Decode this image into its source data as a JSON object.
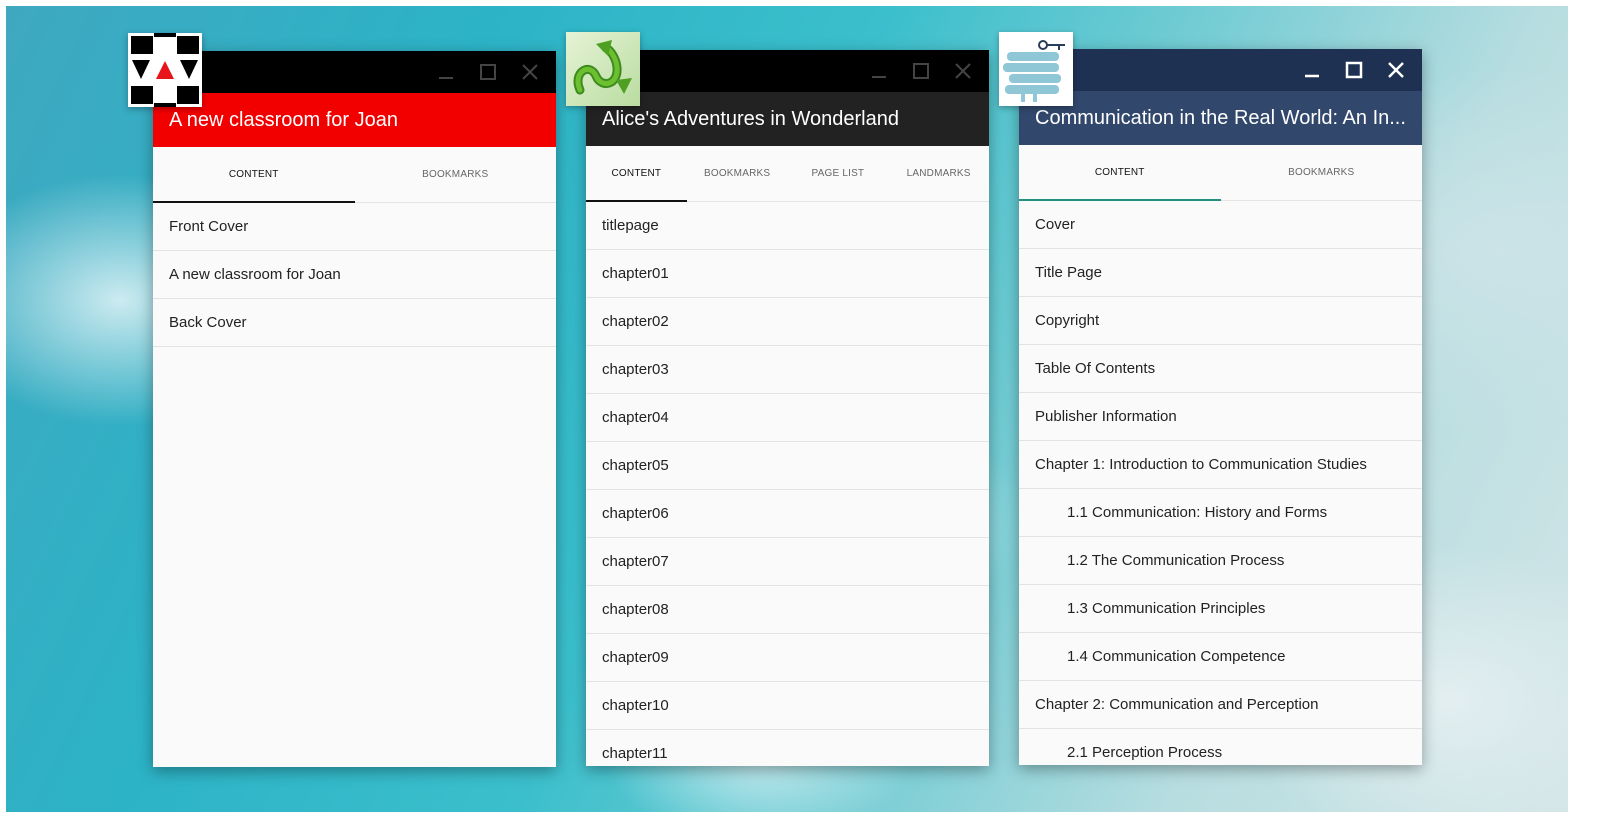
{
  "colors": {
    "win1_header": "#f20000",
    "win1_titlebar": "#000000",
    "win2_header": "#222222",
    "win2_titlebar": "#000000",
    "win3_header": "#31476c",
    "win3_titlebar": "#1e3152",
    "tab_underline_dark": "#111111",
    "tab_underline_teal": "#22907e"
  },
  "windows": [
    {
      "title": "A new classroom for Joan",
      "icon": "vav-app-icon",
      "tabs": [
        {
          "label": "CONTENT",
          "active": true
        },
        {
          "label": "BOOKMARKS",
          "active": false
        }
      ],
      "items": [
        "Front Cover",
        "A new classroom for Joan",
        "Back Cover"
      ]
    },
    {
      "title": "Alice's Adventures in Wonderland",
      "icon": "green-arrows-app-icon",
      "tabs": [
        {
          "label": "CONTENT",
          "active": true
        },
        {
          "label": "BOOKMARKS",
          "active": false
        },
        {
          "label": "PAGE LIST",
          "active": false
        },
        {
          "label": "LANDMARKS",
          "active": false
        }
      ],
      "items": [
        "titlepage",
        "chapter01",
        "chapter02",
        "chapter03",
        "chapter04",
        "chapter05",
        "chapter06",
        "chapter07",
        "chapter08",
        "chapter09",
        "chapter10",
        "chapter11"
      ]
    },
    {
      "title": "Communication in the Real World: An In...",
      "icon": "books-key-app-icon",
      "tabs": [
        {
          "label": "CONTENT",
          "active": true
        },
        {
          "label": "BOOKMARKS",
          "active": false
        }
      ],
      "items": [
        {
          "label": "Cover",
          "indent": false
        },
        {
          "label": "Title Page",
          "indent": false
        },
        {
          "label": "Copyright",
          "indent": false
        },
        {
          "label": "Table Of Contents",
          "indent": false
        },
        {
          "label": "Publisher Information",
          "indent": false
        },
        {
          "label": "Chapter 1: Introduction to Communication Studies",
          "indent": false
        },
        {
          "label": "1.1 Communication: History and Forms",
          "indent": true
        },
        {
          "label": "1.2 The Communication Process",
          "indent": true
        },
        {
          "label": "1.3 Communication Principles",
          "indent": true
        },
        {
          "label": "1.4 Communication Competence",
          "indent": true
        },
        {
          "label": "Chapter 2: Communication and Perception",
          "indent": false
        },
        {
          "label": "2.1 Perception Process",
          "indent": true
        }
      ]
    }
  ]
}
